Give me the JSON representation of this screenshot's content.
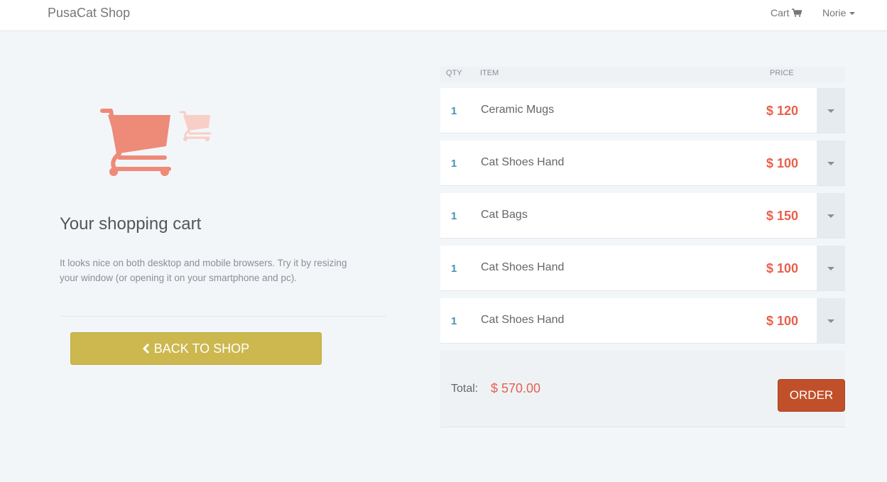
{
  "navbar": {
    "brand": "PusaCat Shop",
    "cart_label": "Cart",
    "user_label": "Norie"
  },
  "intro": {
    "title": "Your shopping cart",
    "description": "It looks nice on both desktop and mobile browsers. Try it by resizing your window (or opening it on your smartphone and pc).",
    "back_button": "BACK TO SHOP"
  },
  "table": {
    "headers": {
      "qty": "QTY",
      "item": "ITEM",
      "price": "PRICE"
    },
    "rows": [
      {
        "qty": "1",
        "item": "Ceramic Mugs",
        "price": "$ 120"
      },
      {
        "qty": "1",
        "item": "Cat Shoes Hand",
        "price": "$ 100"
      },
      {
        "qty": "1",
        "item": "Cat Bags",
        "price": "$ 150"
      },
      {
        "qty": "1",
        "item": "Cat Shoes Hand",
        "price": "$ 100"
      },
      {
        "qty": "1",
        "item": "Cat Shoes Hand",
        "price": "$ 100"
      }
    ]
  },
  "summary": {
    "total_label": "Total:",
    "total_value": "$ 570.00",
    "order_button": "ORDER"
  },
  "colors": {
    "accent_price": "#e8604c",
    "qty_blue": "#4a90b5",
    "back_button": "#ccb84f",
    "order_button": "#c1502a",
    "cart_icon": "#ee8a78"
  }
}
